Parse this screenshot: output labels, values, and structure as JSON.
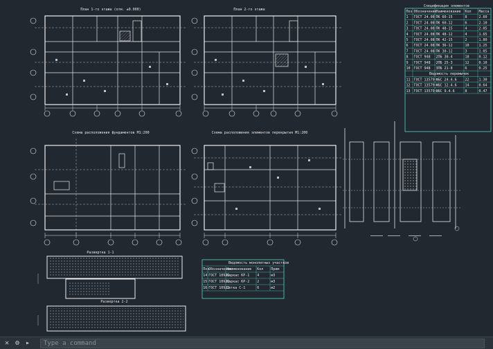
{
  "app": {
    "view": "model-space",
    "background": "#212830"
  },
  "drawing": {
    "title_plan1": "План 1-го этажа (отм. ±0.000)",
    "title_plan2": "План 2-го этажа",
    "title_plan3": "Схема расположения фундаментов М1:200",
    "title_plan4": "Схема расположения элементов перекрытия М1:200",
    "title_strip1": "Развертка 1-1",
    "title_strip2": "Развертка 2-2",
    "spec_title": "Спецификация элементов",
    "spec_header": [
      "Поз",
      "Обозначение",
      "Наименование",
      "Кол",
      "Масса"
    ],
    "spec_rows": [
      [
        "1",
        "ГОСТ 24.08",
        "ПК 60-15",
        "8",
        "2.60"
      ],
      [
        "2",
        "ГОСТ 24.08",
        "ПК 60-12",
        "6",
        "2.10"
      ],
      [
        "3",
        "ГОСТ 24.08",
        "ПК 48-15",
        "4",
        "2.05"
      ],
      [
        "4",
        "ГОСТ 24.08",
        "ПК 48-12",
        "4",
        "1.65"
      ],
      [
        "5",
        "ГОСТ 24.08",
        "ПК 42-15",
        "2",
        "1.80"
      ],
      [
        "6",
        "ГОСТ 24.08",
        "ПК 36-12",
        "10",
        "1.25"
      ],
      [
        "7",
        "ГОСТ 24.08",
        "ПК 30-12",
        "3",
        "1.05"
      ],
      [
        "8",
        "ГОСТ 948",
        "2ПБ 30-4",
        "18",
        "0.12"
      ],
      [
        "9",
        "ГОСТ 948",
        "2ПБ 25-3",
        "12",
        "0.10"
      ],
      [
        "10",
        "ГОСТ 948",
        "3ПБ 21-8",
        "6",
        "0.25"
      ]
    ],
    "spec2_title": "Ведомость перемычек",
    "spec2_rows": [
      [
        "11",
        "ГОСТ 13579",
        "ФБС 24.4.6",
        "22",
        "1.30"
      ],
      [
        "12",
        "ГОСТ 13579",
        "ФБС 12.4.6",
        "14",
        "0.64"
      ],
      [
        "13",
        "ГОСТ 13579",
        "ФБС 9.4.6",
        "8",
        "0.47"
      ]
    ],
    "legend_title": "Ведомость монолитных участков",
    "legend_header": [
      "Поз",
      "Обозначение",
      "Наименование",
      "Кол",
      "Прим"
    ],
    "legend_rows": [
      [
        "14",
        "ГОСТ 10922",
        "Каркас КР-1",
        "4",
        "м3"
      ],
      [
        "15",
        "ГОСТ 10922",
        "Каркас КР-2",
        "2",
        "м3"
      ],
      [
        "16",
        "ГОСТ 10922",
        "Сетка С-1",
        "6",
        "м2"
      ]
    ]
  },
  "cmdline": {
    "placeholder": "Type a command",
    "tools": [
      "close-icon",
      "wrench-icon",
      "prompt-icon"
    ]
  }
}
